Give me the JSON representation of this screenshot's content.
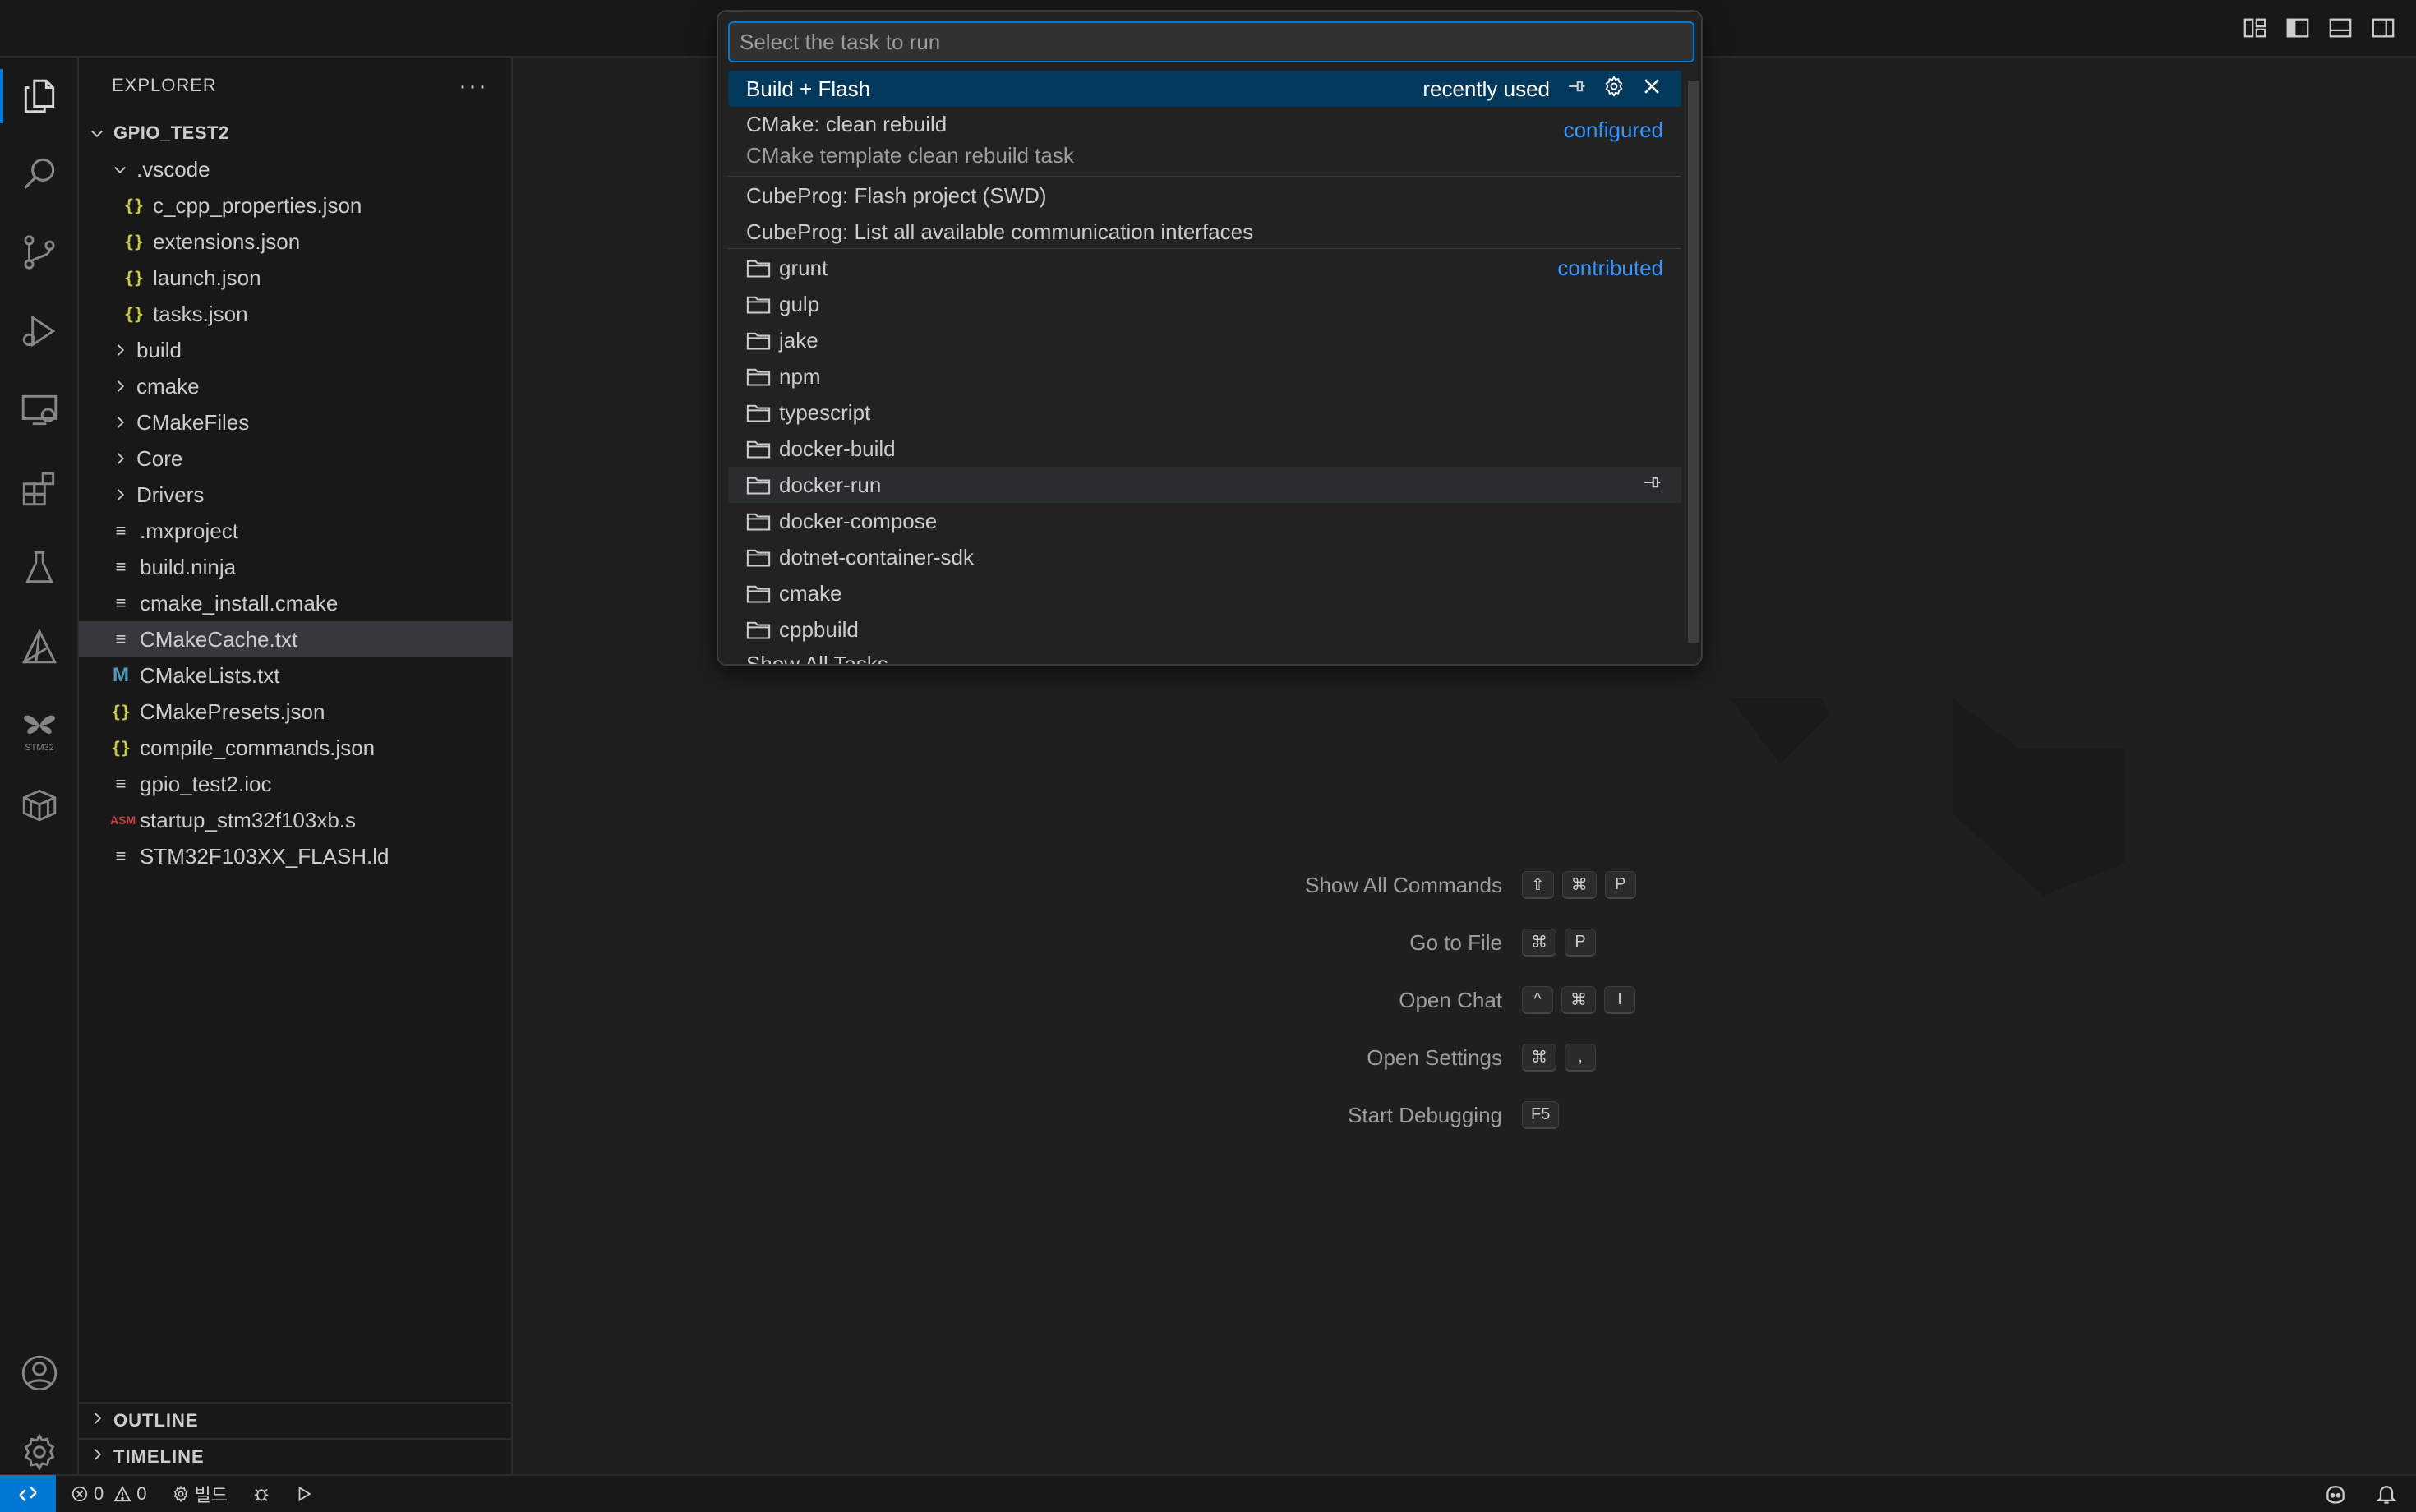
{
  "titlebar": {
    "layout_icons": [
      "customize-layout-icon",
      "toggle-primary-sidebar-icon",
      "toggle-panel-icon",
      "toggle-secondary-sidebar-icon"
    ]
  },
  "activitybar": {
    "items": [
      "explorer-icon",
      "search-icon",
      "source-control-icon",
      "run-debug-icon",
      "remote-explorer-icon",
      "extensions-icon",
      "testing-icon",
      "cmake-icon",
      "stm32-icon",
      "containers-icon"
    ],
    "stm_label": "STM32",
    "bottom": [
      "accounts-icon",
      "manage-gear-icon"
    ]
  },
  "sidebar": {
    "title": "EXPLORER",
    "more": "···",
    "root": "GPIO_TEST2",
    "items": [
      {
        "label": ".vscode",
        "type": "folder-open"
      },
      {
        "label": "c_cpp_properties.json",
        "type": "json"
      },
      {
        "label": "extensions.json",
        "type": "json"
      },
      {
        "label": "launch.json",
        "type": "json"
      },
      {
        "label": "tasks.json",
        "type": "json"
      },
      {
        "label": "build",
        "type": "folder"
      },
      {
        "label": "cmake",
        "type": "folder"
      },
      {
        "label": "CMakeFiles",
        "type": "folder"
      },
      {
        "label": "Core",
        "type": "folder"
      },
      {
        "label": "Drivers",
        "type": "folder"
      },
      {
        "label": ".mxproject",
        "type": "lines"
      },
      {
        "label": "build.ninja",
        "type": "lines"
      },
      {
        "label": "cmake_install.cmake",
        "type": "lines"
      },
      {
        "label": "CMakeCache.txt",
        "type": "lines"
      },
      {
        "label": "CMakeLists.txt",
        "type": "m"
      },
      {
        "label": "CMakePresets.json",
        "type": "json"
      },
      {
        "label": "compile_commands.json",
        "type": "json"
      },
      {
        "label": "gpio_test2.ioc",
        "type": "lines"
      },
      {
        "label": "startup_stm32f103xb.s",
        "type": "asm"
      },
      {
        "label": "STM32F103XX_FLASH.ld",
        "type": "lines"
      }
    ],
    "json_glyph": "{}",
    "lines_glyph": "≡",
    "m_glyph": "M",
    "asm_glyph": "ASM",
    "outline": "OUTLINE",
    "timeline": "TIMELINE"
  },
  "quickpick": {
    "placeholder": "Select the task to run",
    "items": [
      {
        "label": "Build + Flash",
        "tag": "recently used"
      },
      {
        "label": "CMake: clean rebuild",
        "tag": "configured",
        "desc": "CMake template clean rebuild task"
      },
      {
        "label": "CubeProg: Flash project (SWD)"
      },
      {
        "label": "CubeProg: List all available communication interfaces"
      },
      {
        "label": "grunt",
        "tag": "contributed"
      },
      {
        "label": "gulp"
      },
      {
        "label": "jake"
      },
      {
        "label": "npm"
      },
      {
        "label": "typescript"
      },
      {
        "label": "docker-build"
      },
      {
        "label": "docker-run"
      },
      {
        "label": "docker-compose"
      },
      {
        "label": "dotnet-container-sdk"
      },
      {
        "label": "cmake"
      },
      {
        "label": "cppbuild"
      },
      {
        "label": "Show All Tasks..."
      }
    ]
  },
  "shortcuts": [
    {
      "label": "Show All Commands",
      "keys": [
        "⇧",
        "⌘",
        "P"
      ]
    },
    {
      "label": "Go to File",
      "keys": [
        "⌘",
        "P"
      ]
    },
    {
      "label": "Open Chat",
      "keys": [
        "^",
        "⌘",
        "I"
      ]
    },
    {
      "label": "Open Settings",
      "keys": [
        "⌘",
        ","
      ]
    },
    {
      "label": "Start Debugging",
      "keys": [
        "F5"
      ]
    }
  ],
  "statusbar": {
    "errors": "0",
    "warnings": "0",
    "build": "빌드"
  },
  "colors": {
    "accent": "#0078d4",
    "focus_bg": "#04395e",
    "tag_blue": "#3794ff"
  }
}
